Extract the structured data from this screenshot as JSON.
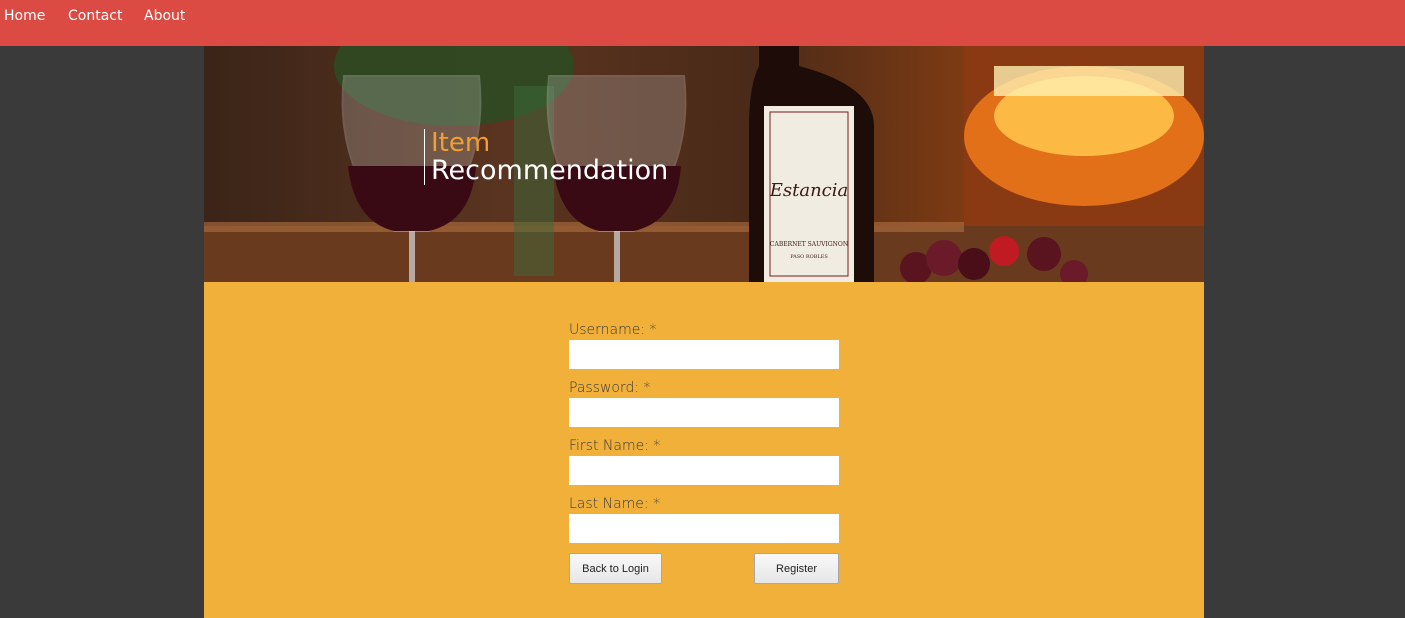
{
  "nav": {
    "home": "Home",
    "contact": "Contact",
    "about": "About"
  },
  "banner": {
    "title_line1": "Item",
    "title_line2": "Recommendation",
    "bottle_label_brand": "Estancia",
    "bottle_label_wine": "CABERNET SAUVIGNON",
    "bottle_label_region": "PASO ROBLES"
  },
  "form": {
    "username_label": "Username: *",
    "password_label": "Password: *",
    "first_name_label": "First Name: *",
    "last_name_label": "Last Name: *",
    "username_value": "",
    "password_value": "",
    "first_name_value": "",
    "last_name_value": "",
    "back_button": "Back to Login",
    "register_button": "Register"
  },
  "colors": {
    "navbar": "#dc4b43",
    "page_background": "#3a3a3a",
    "form_panel": "#f0b03a",
    "title_accent": "#f0a030"
  }
}
